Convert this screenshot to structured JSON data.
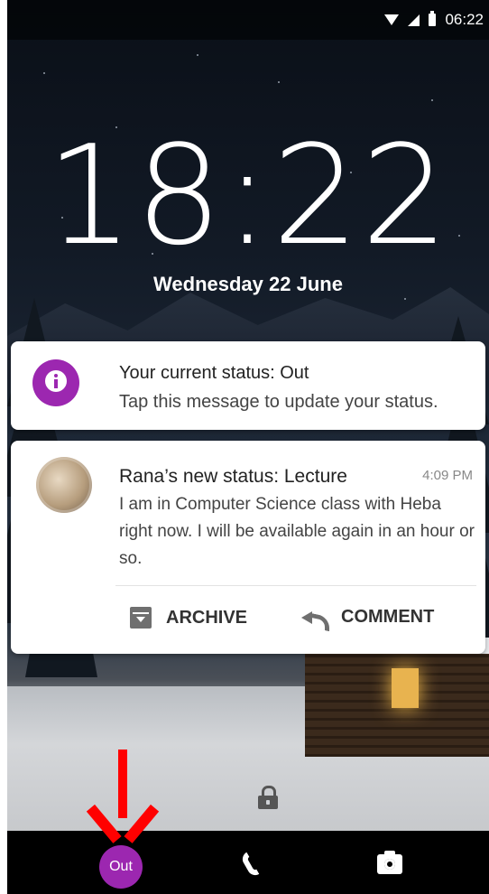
{
  "status_bar": {
    "time": "06:22",
    "icons": [
      "wifi-icon",
      "signal-icon",
      "battery-icon"
    ]
  },
  "lockscreen": {
    "clock": "18:22",
    "date": "Wednesday 22 June"
  },
  "notifications": [
    {
      "icon": "info-icon",
      "title": "Your current status: Out",
      "body": "Tap this message to update your status."
    },
    {
      "avatar": "avatar",
      "title": "Rana’s new status: Lecture",
      "time": "4:09 PM",
      "body": "I am in Computer Science class with Heba right now. I will be available again in an hour or so.",
      "actions": [
        {
          "label": "ARCHIVE",
          "icon": "archive-icon"
        },
        {
          "label": "COMMENT",
          "icon": "reply-icon"
        }
      ]
    }
  ],
  "bottom_bar": {
    "status_button_label": "Out",
    "icons": [
      "phone-icon",
      "camera-icon"
    ]
  },
  "colors": {
    "accent": "#9c27b0",
    "annotation_arrow": "#ff0000"
  }
}
